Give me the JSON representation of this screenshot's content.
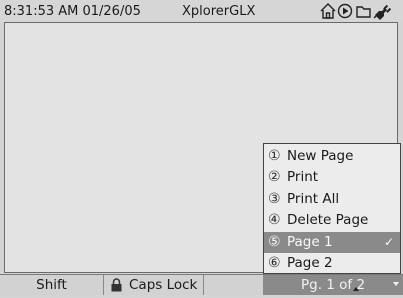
{
  "status_bar": {
    "time_date": "8:31:53 AM  01/26/05",
    "app_name": "XplorerGLX",
    "icons": [
      "home-icon",
      "play-icon",
      "folder-icon",
      "power-plug-icon"
    ]
  },
  "menu": {
    "items": [
      {
        "number": "①",
        "label": "New Page"
      },
      {
        "number": "②",
        "label": "Print"
      },
      {
        "number": "③",
        "label": "Print All"
      },
      {
        "number": "④",
        "label": "Delete Page"
      },
      {
        "number": "⑤",
        "label": "Page 1",
        "check": "✓"
      },
      {
        "number": "⑥",
        "label": "Page 2"
      }
    ]
  },
  "bottom_bar": {
    "shift_label": "Shift",
    "caps_lock_label": "Caps Lock",
    "page_indicator": "Pg. 1 of 2"
  }
}
